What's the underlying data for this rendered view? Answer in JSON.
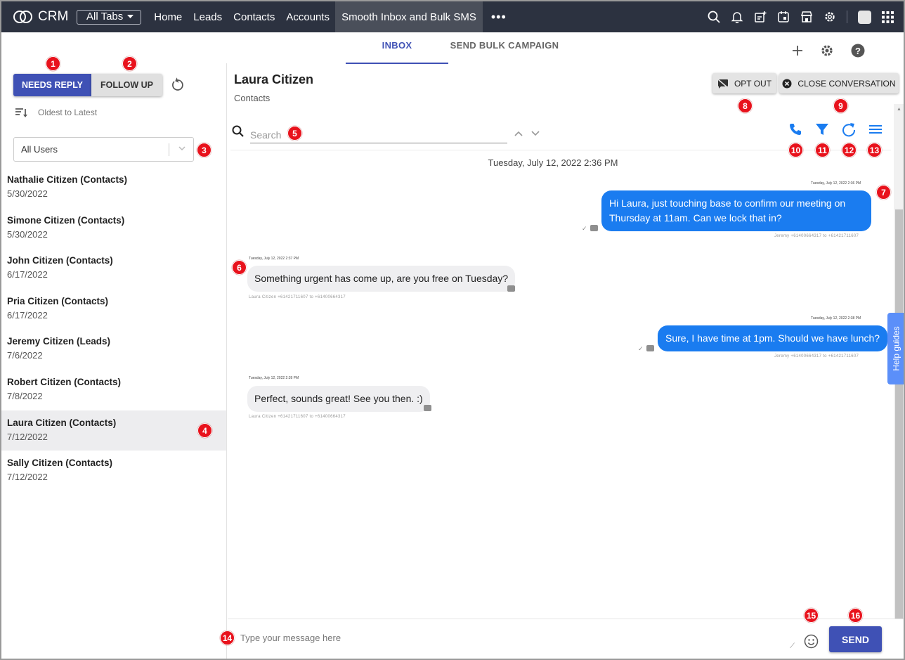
{
  "topnav": {
    "logo": "CRM",
    "all_tabs": "All Tabs",
    "items": [
      "Home",
      "Leads",
      "Contacts",
      "Accounts",
      "Smooth Inbox and Bulk SMS"
    ],
    "more": "•••"
  },
  "tabs": {
    "inbox": "INBOX",
    "bulk": "SEND BULK CAMPAIGN"
  },
  "left": {
    "needs_reply": "NEEDS REPLY",
    "follow_up": "FOLLOW UP",
    "sort_label": "Oldest to Latest",
    "user_filter": "All Users",
    "conversations": [
      {
        "name": "Nathalie Citizen (Contacts)",
        "date": "5/30/2022"
      },
      {
        "name": "Simone Citizen (Contacts)",
        "date": "5/30/2022"
      },
      {
        "name": "John Citizen (Contacts)",
        "date": "6/17/2022"
      },
      {
        "name": "Pria Citizen (Contacts)",
        "date": "6/17/2022"
      },
      {
        "name": "Jeremy Citizen (Leads)",
        "date": "7/6/2022"
      },
      {
        "name": "Robert Citizen (Contacts)",
        "date": "7/8/2022"
      },
      {
        "name": "Laura Citizen (Contacts)",
        "date": "7/12/2022"
      },
      {
        "name": "Sally Citizen (Contacts)",
        "date": "7/12/2022"
      }
    ]
  },
  "conversation": {
    "contact_name": "Laura Citizen",
    "contact_type": "Contacts",
    "opt_out": "OPT OUT",
    "close": "CLOSE CONVERSATION",
    "search_placeholder": "Search",
    "day_header": "Tuesday, July 12, 2022 2:36 PM",
    "messages": [
      {
        "direction": "out",
        "time": "Tuesday, July 12, 2022 2:36 PM",
        "text": "Hi Laura, just touching base to confirm our meeting on Thursday at 11am. Can we lock that in?",
        "meta": "Jeremy +61400664317 to +61421711607"
      },
      {
        "direction": "in",
        "time": "Tuesday, July 12, 2022 2:37 PM",
        "text": "Something urgent has come up, are you free on Tuesday?",
        "meta": "Laura Citizen +61421711607 to +61400664317"
      },
      {
        "direction": "out",
        "time": "Tuesday, July 12, 2022 2:38 PM",
        "text": "Sure, I have time at 1pm. Should we have lunch?",
        "meta": "Jeremy +61400664317 to +61421711607"
      },
      {
        "direction": "in",
        "time": "Tuesday, July 12, 2022 2:39 PM",
        "text": "Perfect, sounds great! See you then. :)",
        "meta": "Laura Citizen +61421711607 to +61400664317"
      }
    ]
  },
  "composer": {
    "placeholder": "Type your message here",
    "send": "SEND"
  },
  "help": "Help guides",
  "badges": [
    "1",
    "2",
    "3",
    "4",
    "5",
    "6",
    "7",
    "8",
    "9",
    "10",
    "11",
    "12",
    "13",
    "14",
    "15",
    "16"
  ],
  "colors": {
    "nav_bg": "#2c3240",
    "primary": "#3f51b5",
    "outgoing_bubble": "#1a7cf0",
    "tool_icon": "#1a7cf0",
    "badge": "#e8121c",
    "help_tab": "#5b8ff9"
  }
}
